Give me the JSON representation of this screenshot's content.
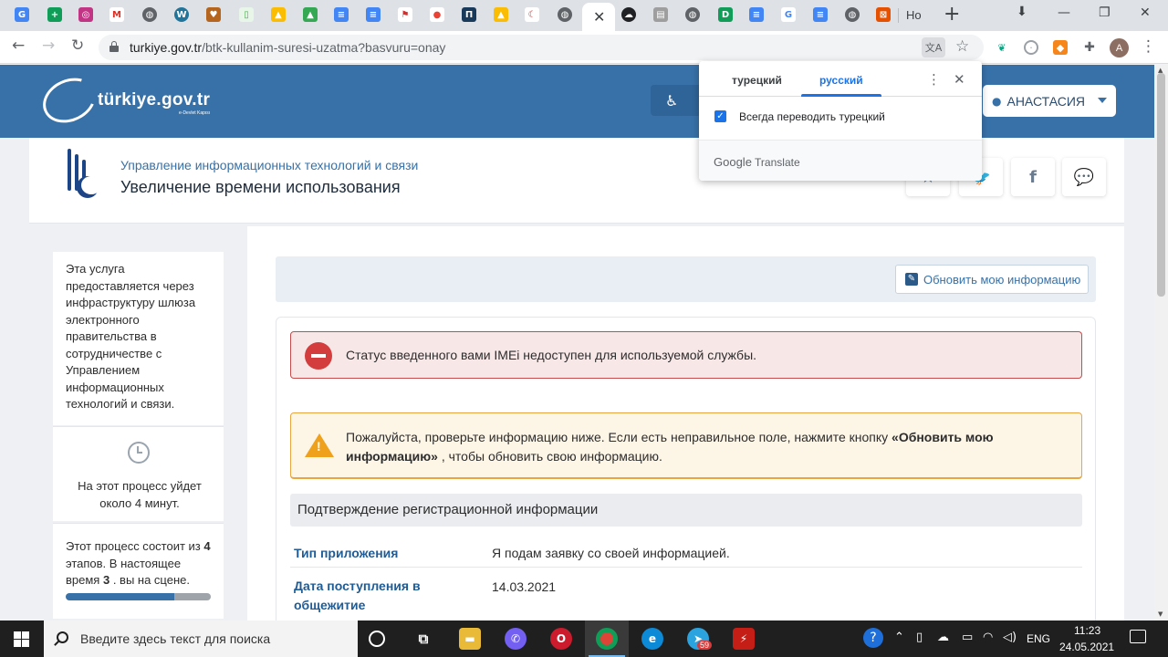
{
  "browser": {
    "tabs": {
      "partial_title": "Ho",
      "active_close": "✕"
    },
    "address": {
      "domain": "turkiye.gov.tr",
      "path": "/btk-kullanim-suresi-uzatma?basvuru=onay"
    },
    "profile_initial": "A"
  },
  "translate_popup": {
    "source_lang": "турецкий",
    "target_lang": "русский",
    "always_translate_label": "Всегда переводить турецкий",
    "always_translate_checked": true,
    "brand": "Google",
    "brand_suffix": "Translate"
  },
  "site": {
    "logo_text": "türkiye.gov.tr",
    "logo_sub": "e-Devlet Kapısı",
    "accessibility_icon": "wheelchair-icon",
    "user_name": "АНАСТАСИЯ"
  },
  "service": {
    "ministry": "Управление информационных технологий и связи",
    "title": "Увеличение времени использования",
    "share_icons": [
      "star-icon",
      "twitter-icon",
      "facebook-icon",
      "comment-icon"
    ]
  },
  "sidebar": {
    "about": "Эта услуга предоставляется через инфраструктуру шлюза электронного правительства в сотрудничестве с Управлением информационных технологий и связи.",
    "duration": "На этот процесс уйдет около 4 минут.",
    "steps_prefix": "Этот процесс состоит из ",
    "steps_total": "4",
    "steps_middle": " этапов. В настоящее время ",
    "steps_current": "3",
    "steps_suffix": " . вы на сцене.",
    "progress_fraction": 0.75
  },
  "main": {
    "update_button": "Обновить мою информацию",
    "error_message": "Статус введенного вами IMEi недоступен для используемой службы.",
    "warning_prefix": "Пожалуйста, проверьте информацию ниже. Если есть неправильное поле, нажмите кнопку ",
    "warning_bold": "«Обновить мою информацию»",
    "warning_suffix": " , чтобы обновить свою информацию.",
    "section_title": "Подтверждение регистрационной информации",
    "rows": [
      {
        "label": "Тип приложения",
        "value": "Я подам заявку со своей информацией."
      },
      {
        "label": "Дата поступления в общежитие",
        "value": "14.03.2021"
      }
    ]
  },
  "taskbar": {
    "search_placeholder": "Введите здесь текст для поиска",
    "telegram_badge": "59",
    "language": "ENG",
    "time": "11:23",
    "date": "24.05.2021"
  },
  "colors": {
    "header_blue": "#3771a8",
    "error_red": "#d33d3d",
    "warning_orange": "#f0a11c",
    "google_blue": "#1a73e8"
  }
}
